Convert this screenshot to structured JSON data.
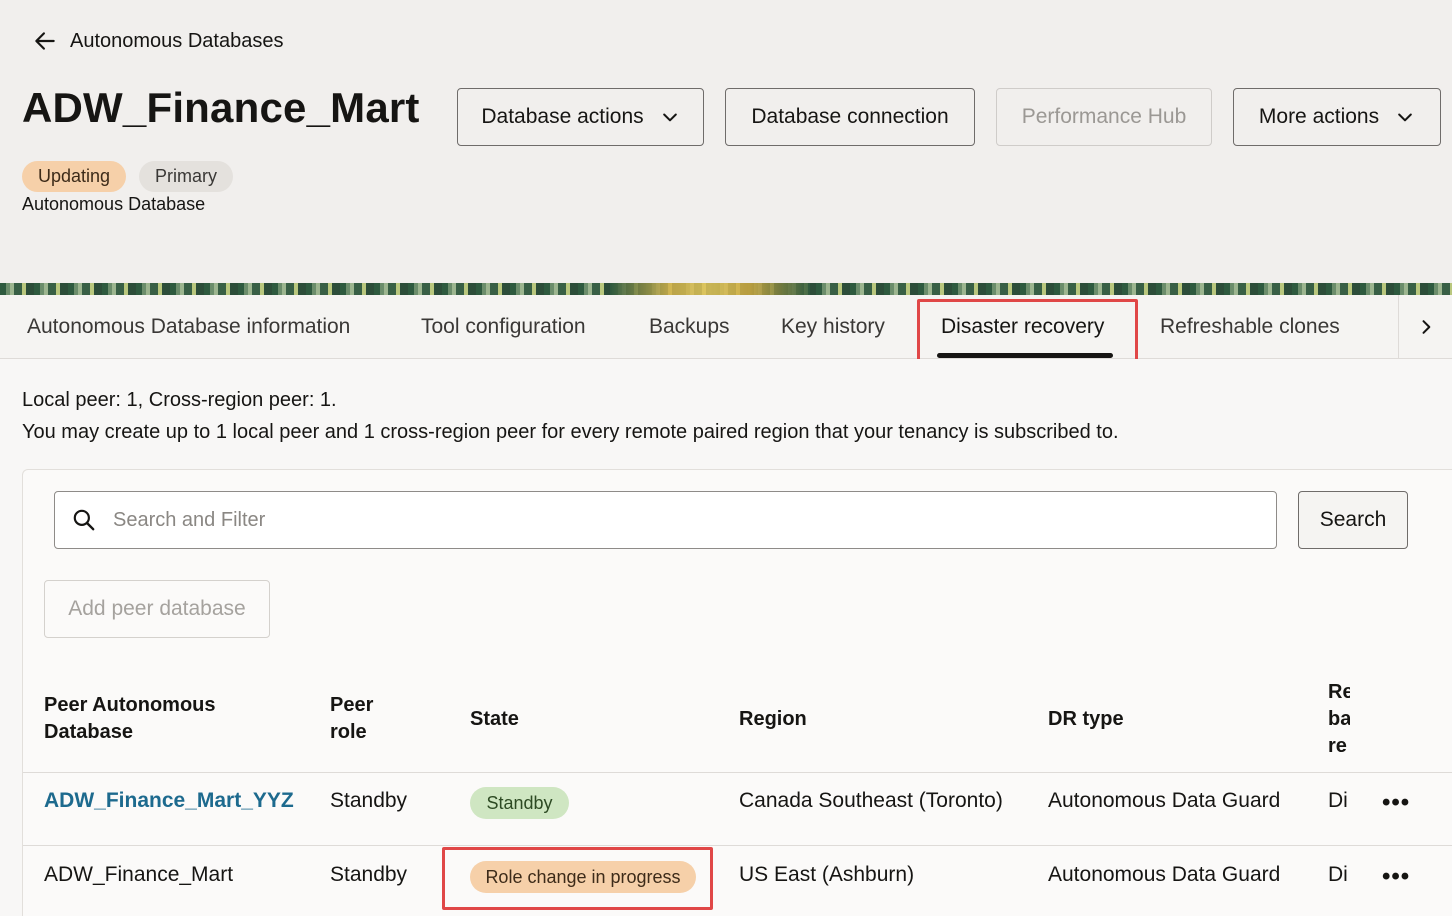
{
  "header": {
    "back_label": "Autonomous Databases",
    "title": "ADW_Finance_Mart",
    "subtitle": "Autonomous Database",
    "badges": [
      "Updating",
      "Primary"
    ],
    "buttons": {
      "database_actions": "Database actions",
      "database_connection": "Database connection",
      "performance_hub": "Performance Hub",
      "more_actions": "More actions"
    }
  },
  "tabs": [
    {
      "label": "Autonomous Database information"
    },
    {
      "label": "Tool configuration"
    },
    {
      "label": "Backups"
    },
    {
      "label": "Key history"
    },
    {
      "label": "Disaster recovery",
      "active": true
    },
    {
      "label": "Refreshable clones"
    }
  ],
  "main": {
    "info_line1": "Local peer: 1, Cross-region peer: 1.",
    "info_line2": "You may create up to 1 local peer and 1 cross-region peer for every remote paired region that your tenancy is subscribed to.",
    "search_placeholder": "Search and Filter",
    "search_button": "Search",
    "add_peer_button": "Add peer database"
  },
  "table": {
    "columns": {
      "peer_db_line1": "Peer Autonomous",
      "peer_db_line2": "Database",
      "peer_role_line1": "Peer",
      "peer_role_line2": "role",
      "state": "State",
      "region": "Region",
      "dr_type": "DR type",
      "truncated_line1": "Re",
      "truncated_line2": "ba",
      "truncated_line3": "re"
    },
    "rows": [
      {
        "name": "ADW_Finance_Mart_YYZ",
        "role": "Standby",
        "state": "Standby",
        "region": "Canada Southeast (Toronto)",
        "dr_type": "Autonomous Data Guard",
        "truncated": "Di",
        "actions": "•••"
      },
      {
        "name": "ADW_Finance_Mart",
        "role": "Standby",
        "state": "Role change in progress",
        "region": "US East (Ashburn)",
        "dr_type": "Autonomous Data Guard",
        "truncated": "Di",
        "actions": "•••"
      }
    ]
  },
  "colors": {
    "accent_link": "#1d6a8e",
    "highlight": "#e04747",
    "badge_orange": "#f6d0a9",
    "badge_green": "#cfe6c2"
  }
}
